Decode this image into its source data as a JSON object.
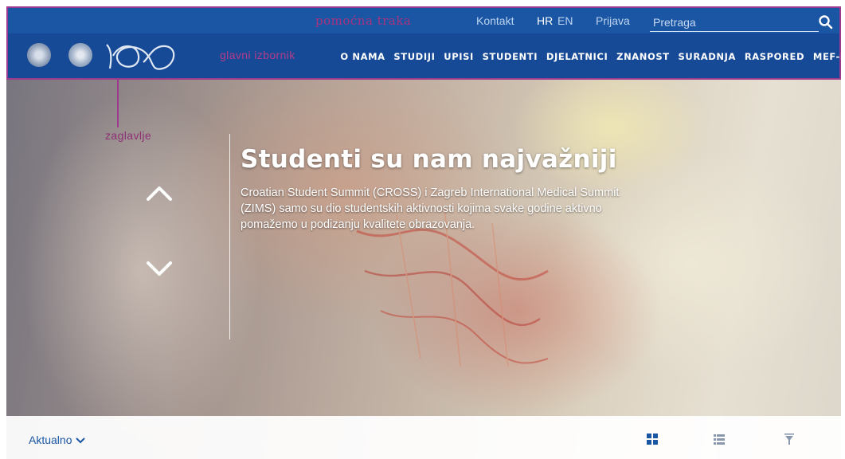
{
  "annotations": {
    "utility": "pomoćna traka",
    "main_menu": "glavni izbornik",
    "header": "zaglavlje"
  },
  "utility_bar": {
    "contact": "Kontakt",
    "lang_hr": "HR",
    "lang_en": "EN",
    "login": "Prijava",
    "search_placeholder": "Pretraga"
  },
  "main_menu": {
    "items": [
      {
        "label": "O NAMA"
      },
      {
        "label": "STUDIJI"
      },
      {
        "label": "UPISI"
      },
      {
        "label": "STUDENTI"
      },
      {
        "label": "DJELATNICI"
      },
      {
        "label": "ZNANOST"
      },
      {
        "label": "SURADNJA"
      },
      {
        "label": "RASPORED"
      },
      {
        "label": "MEF-LMS"
      }
    ]
  },
  "hero": {
    "title": "Studenti su nam najvažniji",
    "text": "Croatian Student Summit (CROSS) i Zagreb International Medical Summit (ZIMS) samo su dio studentskih aktivnosti kojima svake godine aktivno pomažemo u podizanju kvalitete obrazovanja."
  },
  "news": {
    "section_label": "Aktualno"
  },
  "colors": {
    "utility_bg": "#1a56a3",
    "nav_bg": "#174a96",
    "annotation": "#9b3a8e",
    "link": "#1a56a3"
  },
  "icons": [
    "search-icon",
    "crest-icon",
    "centenary-logo",
    "chevron-up-icon",
    "chevron-down-icon",
    "grid-view-icon",
    "list-view-icon",
    "filter-icon"
  ]
}
